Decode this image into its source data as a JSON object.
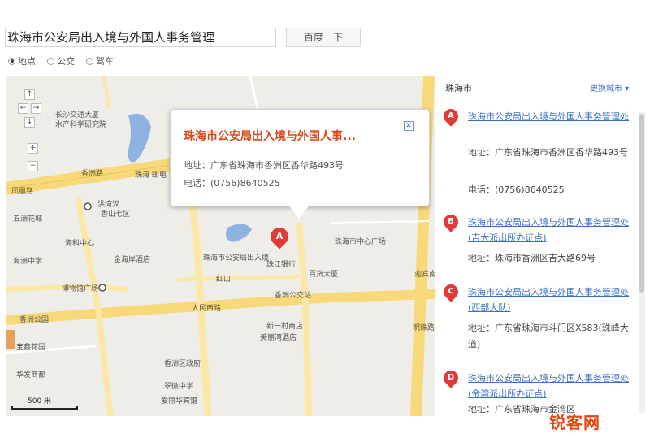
{
  "search": {
    "value": "珠海市公安局出入境与外国人事务管理",
    "button_label": "百度一下",
    "modes": [
      {
        "label": "地点",
        "selected": true
      },
      {
        "label": "公交",
        "selected": false
      },
      {
        "label": "驾车",
        "selected": false
      }
    ]
  },
  "map": {
    "popup": {
      "title": "珠海市公安局出入境与外国人事...",
      "address": "地址：广东省珠海市香洲区香华路493号",
      "phone": "电话：(0756)8640525",
      "close": "✕"
    },
    "marker_label": "A",
    "scale": "500 米",
    "zoom_controls": [
      "↑",
      "←",
      "→",
      "↓",
      "+",
      "−"
    ],
    "pois": [
      "长沙交通大厦",
      "水产科学研究院",
      "珠海 邮电",
      "洪湾汉",
      "五洲花城",
      "香山七区",
      "海科中心",
      "海洲中学",
      "金海岸酒店",
      "珠海市中心广场",
      "珠江银行",
      "红山",
      "博物馆广场",
      "珠海市公安局出入境",
      "香洲公交站",
      "香洲公园",
      "百货大厦",
      "新一村商店",
      "宝鑫花园",
      "美丽湾酒店",
      "香洲区政府",
      "华发商都",
      "翠微中学",
      "爱丽华宾馆"
    ],
    "road_labels": [
      "凤凰路",
      "人民西路",
      "迎宾南路",
      "明珠路",
      "香洲路"
    ]
  },
  "results": {
    "city": "珠海市",
    "more_cities": "更换城市 ▾",
    "items": [
      {
        "marker": "A",
        "name": "珠海市公安局出入境与外国人事务管理处",
        "lines": [
          "地址：广东省珠海市香洲区香华路493号",
          "电话：(0756)8640525"
        ]
      },
      {
        "marker": "B",
        "name": "珠海市公安局出入境与外国人事务管理处(吉大派出所办证点)",
        "lines": [
          "地址：珠海市香洲区吉大路69号"
        ]
      },
      {
        "marker": "C",
        "name": "珠海市公安局出入境与外国人事务管理处(西部大队)",
        "lines": [
          "地址：广东省珠海市斗门区X583(珠峰大道)"
        ]
      },
      {
        "marker": "D",
        "name": "珠海市公安局出入境与外国人事务管理处(金湾派出所办证点)",
        "lines": [
          "地址：广东省珠海市金湾区"
        ]
      }
    ]
  },
  "watermark": "锐客网",
  "colors": {
    "accent": "#3a6fc4",
    "marker": "#e03a3a",
    "title": "#d9481b",
    "road": "#f7d97a"
  }
}
